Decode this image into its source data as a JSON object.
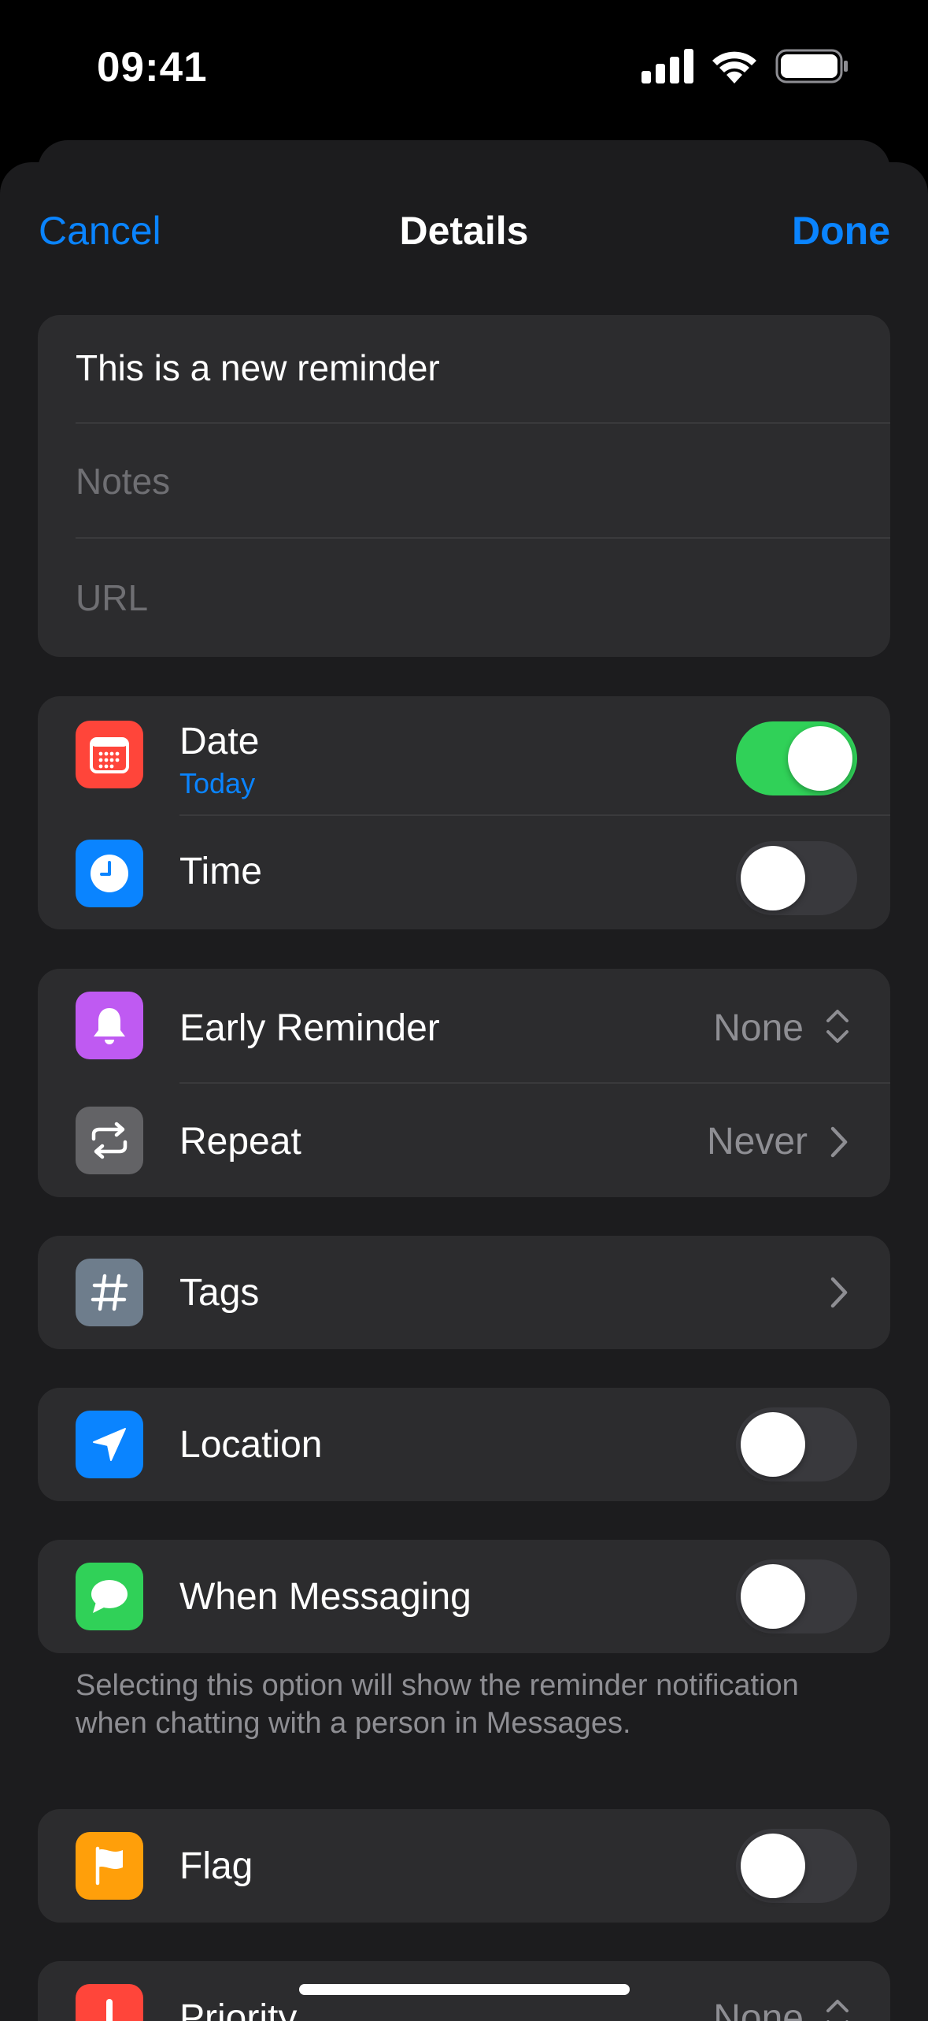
{
  "status_bar": {
    "time": "09:41"
  },
  "nav": {
    "cancel": "Cancel",
    "title": "Details",
    "done": "Done"
  },
  "reminder": {
    "title": "This is a new reminder",
    "notes_placeholder": "Notes",
    "url_placeholder": "URL"
  },
  "date_time": {
    "date_label": "Date",
    "date_value": "Today",
    "date_enabled": true,
    "time_label": "Time",
    "time_enabled": false
  },
  "alerts": {
    "early_label": "Early Reminder",
    "early_value": "None",
    "repeat_label": "Repeat",
    "repeat_value": "Never"
  },
  "tags": {
    "label": "Tags"
  },
  "location": {
    "label": "Location",
    "enabled": false
  },
  "messaging": {
    "label": "When Messaging",
    "enabled": false,
    "footnote": "Selecting this option will show the reminder notification when chatting with a person in Messages."
  },
  "flag": {
    "label": "Flag",
    "enabled": false
  },
  "priority": {
    "label": "Priority",
    "value": "None"
  },
  "colors": {
    "accent": "#0a84ff",
    "toggle_on": "#30d158",
    "date_icon": "#ff453a",
    "time_icon": "#0a84ff",
    "early_icon": "#bf5af2",
    "repeat_icon": "#636366",
    "tags_icon": "#6e7d8c",
    "location_icon": "#0a84ff",
    "messaging_icon": "#30d158",
    "flag_icon": "#ff9f0a",
    "priority_icon": "#ff453a"
  }
}
